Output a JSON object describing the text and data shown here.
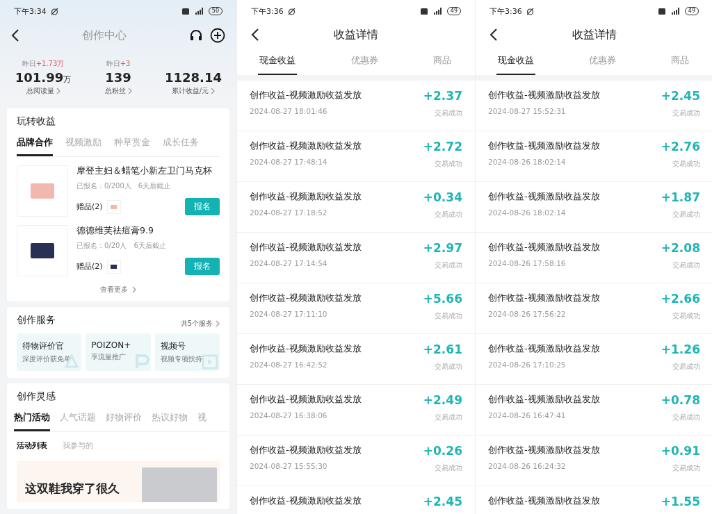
{
  "screens": [
    {
      "kind": "creator",
      "status_bar": {
        "time": "下午3:34",
        "battery": "50"
      },
      "title": "创作中心",
      "stats": [
        {
          "delta_label": "昨日",
          "delta": "+1.73万",
          "value": "101.99",
          "unit": "万",
          "label": "总阅读量"
        },
        {
          "delta_label": "昨日",
          "delta": "+3",
          "value": "139",
          "label": "总粉丝"
        },
        {
          "value": "1128.14",
          "label": "累计收益/元"
        }
      ],
      "earn_card": {
        "title": "玩转收益",
        "tabs": [
          {
            "label": "品牌合作",
            "selected": true
          },
          {
            "label": "视频激励",
            "selected": false
          },
          {
            "label": "种草赏金",
            "selected": false
          },
          {
            "label": "成长任务",
            "selected": false
          }
        ],
        "items": [
          {
            "title": "摩登主妇＆蜡笔小新左卫门马克杯",
            "signed": "已报名：0/200人",
            "deadline": "6天后截止",
            "gift": "赠品(2)",
            "button": "报名",
            "color": "#f2b8b0"
          },
          {
            "title": "德德维芙祛痘膏9.9",
            "signed": "已报名：0/20人",
            "deadline": "6天后截止",
            "gift": "赠品(2)",
            "button": "报名",
            "color": "#2a2f55"
          }
        ],
        "more": "查看更多"
      },
      "service_card": {
        "title": "创作服务",
        "more": "共5个服务",
        "tiles": [
          {
            "title": "得物评价官",
            "subtitle": "深度评价获免单"
          },
          {
            "title": "POIZON+",
            "subtitle": "享流量推广"
          },
          {
            "title": "视频号",
            "subtitle": "视频专项扶持"
          }
        ]
      },
      "idea_card": {
        "title": "创作灵感",
        "tabs": [
          {
            "label": "热门活动",
            "selected": true
          },
          {
            "label": "人气话题",
            "selected": false
          },
          {
            "label": "好物评价",
            "selected": false
          },
          {
            "label": "热议好物",
            "selected": false
          },
          {
            "label": "视",
            "selected": false
          }
        ],
        "subtabs": [
          {
            "label": "活动列表",
            "selected": true
          },
          {
            "label": "我参与的",
            "selected": false
          }
        ],
        "banner_text": "这双鞋我穿了很久"
      }
    },
    {
      "kind": "income",
      "status_bar": {
        "time": "下午3:36",
        "battery": "49"
      },
      "title": "收益详情",
      "tabs": [
        {
          "label": "现金收益",
          "selected": true
        },
        {
          "label": "优惠券",
          "selected": false
        },
        {
          "label": "商品",
          "selected": false
        }
      ],
      "rows": [
        {
          "title": "创作收益-视频激励收益发放",
          "time": "2024-08-27 18:01:46",
          "amount": "+2.37",
          "status": "交易成功"
        },
        {
          "title": "创作收益-视频激励收益发放",
          "time": "2024-08-27 17:48:14",
          "amount": "+2.72",
          "status": "交易成功"
        },
        {
          "title": "创作收益-视频激励收益发放",
          "time": "2024-08-27 17:18:52",
          "amount": "+0.34",
          "status": "交易成功"
        },
        {
          "title": "创作收益-视频激励收益发放",
          "time": "2024-08-27 17:14:54",
          "amount": "+2.97",
          "status": "交易成功"
        },
        {
          "title": "创作收益-视频激励收益发放",
          "time": "2024-08-27 17:11:10",
          "amount": "+5.66",
          "status": "交易成功"
        },
        {
          "title": "创作收益-视频激励收益发放",
          "time": "2024-08-27 16:42:52",
          "amount": "+2.61",
          "status": "交易成功"
        },
        {
          "title": "创作收益-视频激励收益发放",
          "time": "2024-08-27 16:38:06",
          "amount": "+2.49",
          "status": "交易成功"
        },
        {
          "title": "创作收益-视频激励收益发放",
          "time": "2024-08-27 15:55:30",
          "amount": "+0.26",
          "status": "交易成功"
        },
        {
          "title": "创作收益-视频激励收益发放",
          "amount": "+2.45"
        }
      ]
    },
    {
      "kind": "income",
      "status_bar": {
        "time": "下午3:36",
        "battery": "49"
      },
      "title": "收益详情",
      "tabs": [
        {
          "label": "现金收益",
          "selected": true
        },
        {
          "label": "优惠券",
          "selected": false
        },
        {
          "label": "商品",
          "selected": false
        }
      ],
      "rows": [
        {
          "title": "创作收益-视频激励收益发放",
          "time": "2024-08-27 15:52:31",
          "amount": "+2.45",
          "status": "交易成功"
        },
        {
          "title": "创作收益-视频激励收益发放",
          "time": "2024-08-26 18:02:14",
          "amount": "+2.76",
          "status": "交易成功"
        },
        {
          "title": "创作收益-视频激励收益发放",
          "time": "2024-08-26 18:02:14",
          "amount": "+1.87",
          "status": "交易成功"
        },
        {
          "title": "创作收益-视频激励收益发放",
          "time": "2024-08-26 17:58:16",
          "amount": "+2.08",
          "status": "交易成功"
        },
        {
          "title": "创作收益-视频激励收益发放",
          "time": "2024-08-26 17:56:22",
          "amount": "+2.66",
          "status": "交易成功"
        },
        {
          "title": "创作收益-视频激励收益发放",
          "time": "2024-08-26 17:10:25",
          "amount": "+1.26",
          "status": "交易成功"
        },
        {
          "title": "创作收益-视频激励收益发放",
          "time": "2024-08-26 16:47:41",
          "amount": "+0.78",
          "status": "交易成功"
        },
        {
          "title": "创作收益-视频激励收益发放",
          "time": "2024-08-26 16:24:32",
          "amount": "+0.91",
          "status": "交易成功"
        },
        {
          "title": "创作收益-视频激励收益发放",
          "amount": "+1.55"
        }
      ]
    }
  ]
}
